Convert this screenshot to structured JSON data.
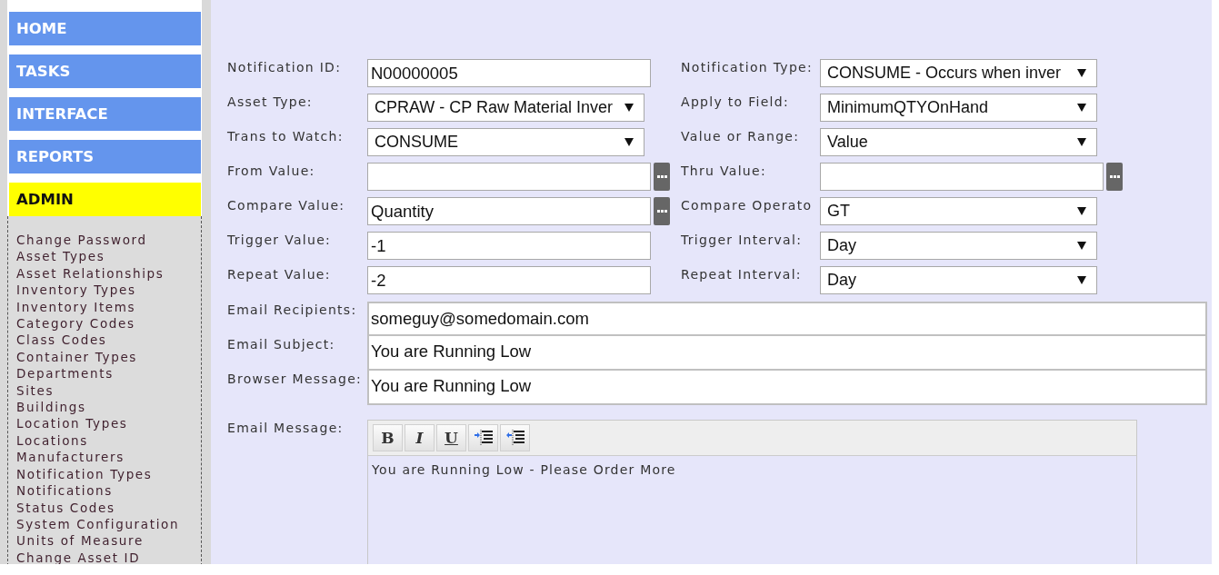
{
  "sidebar": {
    "nav": [
      {
        "label": "HOME",
        "selected": false
      },
      {
        "label": "TASKS",
        "selected": false
      },
      {
        "label": "INTERFACE",
        "selected": false
      },
      {
        "label": "REPORTS",
        "selected": false
      },
      {
        "label": "ADMIN",
        "selected": true,
        "children": [
          {
            "label": "Change Password"
          },
          {
            "label": "Asset Types"
          },
          {
            "label": "Asset Relationships"
          },
          {
            "label": "Inventory Types"
          },
          {
            "label": "Inventory Items"
          },
          {
            "label": "Category Codes"
          },
          {
            "label": "Class Codes"
          },
          {
            "label": "Container Types"
          },
          {
            "label": "Departments"
          },
          {
            "label": "Sites"
          },
          {
            "label": "Buildings"
          },
          {
            "label": "Location Types"
          },
          {
            "label": "Locations"
          },
          {
            "label": "Manufacturers"
          },
          {
            "label": "Notification Types"
          },
          {
            "label": "Notifications"
          },
          {
            "label": "Status Codes"
          },
          {
            "label": "System Configuration"
          },
          {
            "label": "Units of Measure"
          },
          {
            "label": "Change Asset ID"
          }
        ]
      }
    ]
  },
  "form": {
    "rows": [
      {
        "left": {
          "label": "Notification ID:",
          "kind": "text",
          "value": "N00000005",
          "browse": false
        },
        "right": {
          "label": "Notification Type:",
          "kind": "select",
          "value": "CONSUME - Occurs when inver",
          "browse": false
        }
      },
      {
        "left": {
          "label": "Asset Type:",
          "kind": "select",
          "value": "CPRAW - CP Raw Material Inver",
          "browse": false
        },
        "right": {
          "label": "Apply to Field:",
          "kind": "select",
          "value": "MinimumQTYOnHand",
          "browse": false
        }
      },
      {
        "left": {
          "label": "Trans to Watch:",
          "kind": "select",
          "value": "CONSUME",
          "browse": false
        },
        "right": {
          "label": "Value or Range:",
          "kind": "select",
          "value": "Value",
          "browse": false
        }
      },
      {
        "left": {
          "label": "From Value:",
          "kind": "text",
          "browse": true
        },
        "right": {
          "label": "Thru Value:",
          "kind": "text",
          "browse": true
        }
      },
      {
        "left": {
          "label": "Compare Value:",
          "kind": "text",
          "value": "Quantity",
          "browse": true
        },
        "right": {
          "label": "Compare Operato",
          "kind": "select",
          "value": "GT",
          "browse": false
        }
      },
      {
        "left": {
          "label": "Trigger Value:",
          "kind": "text",
          "value": "-1",
          "browse": false
        },
        "right": {
          "label": "Trigger Interval:",
          "kind": "select",
          "value": "Day",
          "browse": false
        }
      },
      {
        "left": {
          "label": "Repeat Value:",
          "kind": "text",
          "value": "-2",
          "browse": false
        },
        "right": {
          "label": "Repeat Interval:",
          "kind": "select",
          "value": "Day",
          "browse": false
        }
      }
    ],
    "wide_fields": [
      {
        "label": "Email Recipients:",
        "value": "someguy@somedomain.com"
      },
      {
        "label": "Email Subject:",
        "value": "You are Running Low"
      },
      {
        "label": "Browser Message:",
        "value": "You are Running Low"
      }
    ],
    "email_message": {
      "label": "Email Message:",
      "toolbar": [
        {
          "kind": "bold",
          "label": "B"
        },
        {
          "kind": "italic",
          "label": "I"
        },
        {
          "kind": "underline",
          "label": "U"
        },
        {
          "kind": "indent"
        },
        {
          "kind": "outdent"
        }
      ],
      "body": "You are Running Low - Please Order More"
    }
  }
}
